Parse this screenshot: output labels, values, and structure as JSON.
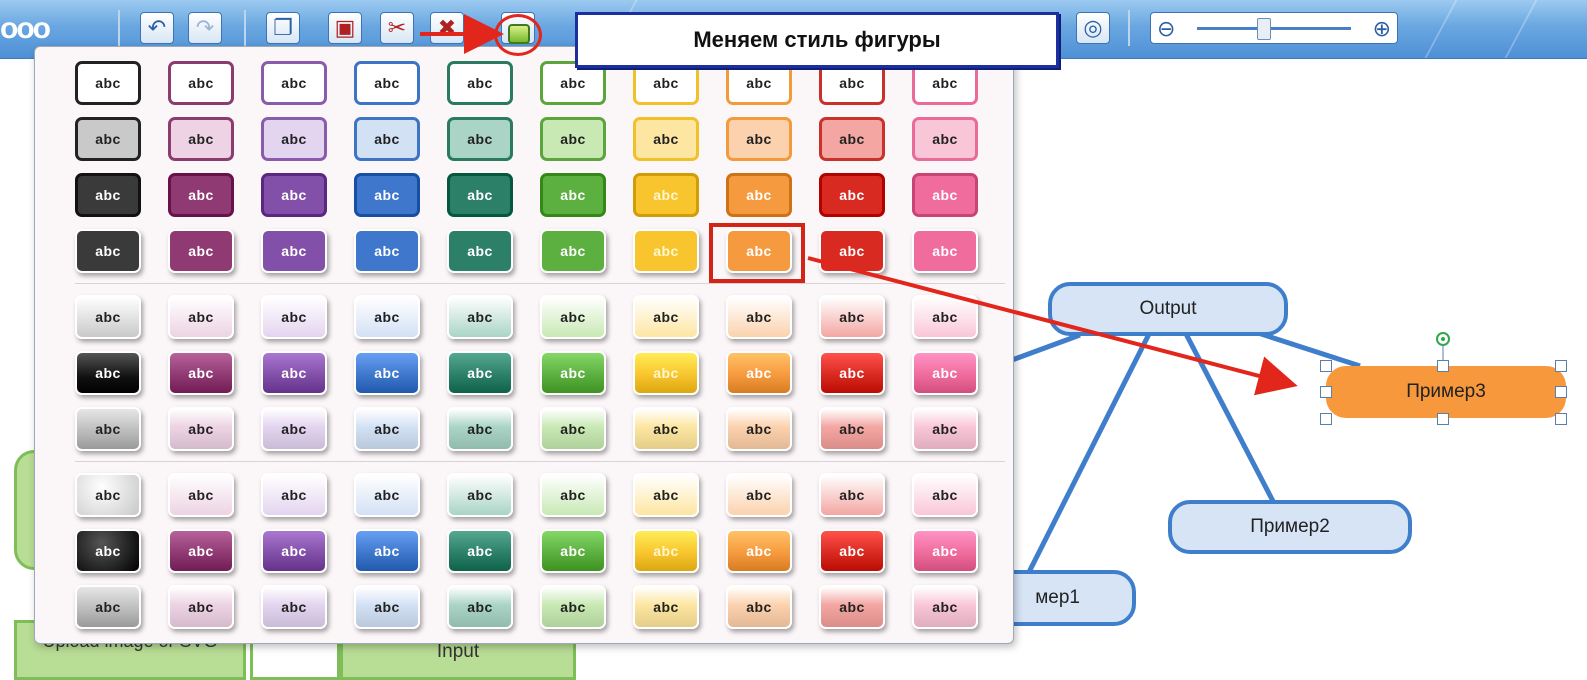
{
  "callout": {
    "text": "Меняем стиль фигуры"
  },
  "palette": {
    "cell_label": "abc",
    "columns": [
      {
        "name": "black",
        "border": "#222222",
        "light": "#c9c9c9",
        "mid": "#3a3a3a",
        "text_dark": "#222222"
      },
      {
        "name": "plum",
        "border": "#8b3c6e",
        "light": "#edd3e3",
        "mid": "#8f3a72",
        "text_dark": "#222222"
      },
      {
        "name": "purple",
        "border": "#8a5aab",
        "light": "#e3d4ef",
        "mid": "#8250a8",
        "text_dark": "#222222"
      },
      {
        "name": "blue",
        "border": "#3e74c4",
        "light": "#d3e1f5",
        "mid": "#3f77cc",
        "text_dark": "#222222"
      },
      {
        "name": "teal",
        "border": "#2a7a62",
        "light": "#a9d4c6",
        "mid": "#2d8068",
        "text_dark": "#222222"
      },
      {
        "name": "green",
        "border": "#5ba53c",
        "light": "#c8e9b4",
        "mid": "#5cb040",
        "text_dark": "#222222"
      },
      {
        "name": "yellow",
        "border": "#f2c02a",
        "light": "#fde6a2",
        "mid": "#f8c52e",
        "text_dark": "#222222"
      },
      {
        "name": "orange",
        "border": "#f39a3a",
        "light": "#fbd2ad",
        "mid": "#f69a3f",
        "text_dark": "#222222"
      },
      {
        "name": "red",
        "border": "#c9322a",
        "light": "#f3a6a2",
        "mid": "#d92a22",
        "text_dark": "#222222"
      },
      {
        "name": "pink",
        "border": "#ea6b9a",
        "light": "#f9c6d8",
        "mid": "#ef6c9d",
        "text_dark": "#222222"
      }
    ],
    "row_styles": [
      "s0",
      "s1",
      "s2",
      "s3",
      "g0",
      "g1",
      "g2",
      "g0",
      "g1",
      "g2"
    ]
  },
  "canvas": {
    "nodes": {
      "output": "Output",
      "example3": "Пример3",
      "example2": "Пример2",
      "example1": "мер1"
    },
    "partial_labels": {
      "left": "Upload image or SVG",
      "input": "Input"
    },
    "colors": {
      "connector": "#3f7ecb",
      "selected_fill": "#f7983c",
      "annotation_red": "#e2261c"
    }
  },
  "toolbar": {
    "logo": "ooo",
    "icons": [
      "undo-icon",
      "redo-icon",
      "copy-icon",
      "paste-icon",
      "cut-icon",
      "delete-icon",
      "style-icon",
      "snapshot-icon",
      "zoom-out-icon",
      "zoom-in-icon"
    ],
    "zoom_level": 0.42
  }
}
